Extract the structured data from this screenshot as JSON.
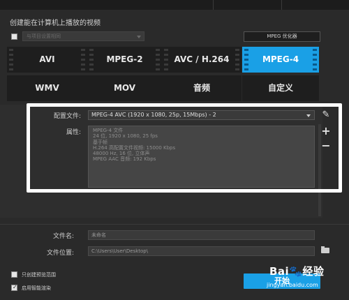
{
  "window": {
    "title_bar_label": ""
  },
  "section": {
    "title": "创建能在计算机上播放的视频"
  },
  "top_controls": {
    "disabled_checkbox_label": "与项目设置相同",
    "optimizer_button": "MPEG 优化器"
  },
  "formats": [
    {
      "label": "AVI",
      "active": false
    },
    {
      "label": "MPEG-2",
      "active": false
    },
    {
      "label": "AVC / H.264",
      "active": false
    },
    {
      "label": "MPEG-4",
      "active": true
    },
    {
      "label": "WMV",
      "active": false
    },
    {
      "label": "MOV",
      "active": false
    },
    {
      "label": "音频",
      "active": false
    },
    {
      "label": "自定义",
      "active": false
    }
  ],
  "profile": {
    "label": "配置文件:",
    "value": "MPEG-4 AVC (1920 x 1080, 25p, 15Mbps) - 2"
  },
  "properties": {
    "label": "属性:",
    "lines": [
      "MPEG-4 文件",
      "24 位, 1920 x 1080, 25 fps",
      "基于帧",
      "H.264 高配置文件视频: 15000 Kbps",
      "48000 Hz, 16 位, 立体声",
      "MPEG AAC 音频: 192 Kbps"
    ]
  },
  "side_icons": {
    "edit": "✎",
    "add": "+",
    "remove": "−"
  },
  "file": {
    "name_label": "文件名:",
    "name_value": "未命名",
    "location_label": "文件位置:",
    "location_value": "C:\\Users\\User\\Desktop\\"
  },
  "options": {
    "preview_only_label": "只创建预览范围",
    "smart_render_label": "启用智能渲染",
    "preview_only_checked": false,
    "smart_render_checked": true
  },
  "start_button": "开始",
  "watermark": {
    "brand": "Bai",
    "paw": "🐾",
    "suffix": "经验",
    "url": "jingyan.baidu.com"
  },
  "colors": {
    "accent": "#1aa0e6",
    "background": "#2a2a2a",
    "tile": "#1e1e1e"
  }
}
